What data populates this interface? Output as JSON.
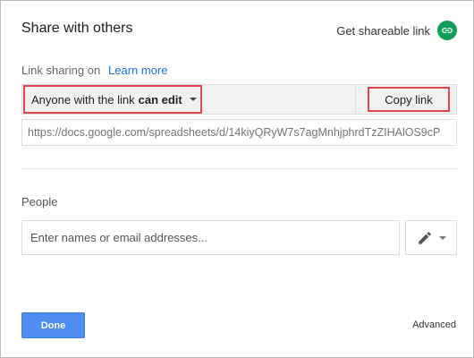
{
  "dialog": {
    "title": "Share with others",
    "get_link_label": "Get shareable link",
    "link_icon": "link-icon",
    "link_icon_color": "#0f9d58"
  },
  "link_sharing": {
    "label": "Link sharing on",
    "learn_more": "Learn more",
    "access_prefix": "Anyone with the link",
    "access_level": "can edit",
    "copy_label": "Copy link",
    "url": "https://docs.google.com/spreadsheets/d/14kiyQRyW7s7agMnhjphrdTzZIHAlOS9cP"
  },
  "people": {
    "label": "People",
    "placeholder": "Enter names or email addresses...",
    "permission_icon": "pencil-icon"
  },
  "footer": {
    "done_label": "Done",
    "done_color": "#4d8ef0",
    "advanced_label": "Advanced"
  },
  "highlight_color": "#e0464b"
}
